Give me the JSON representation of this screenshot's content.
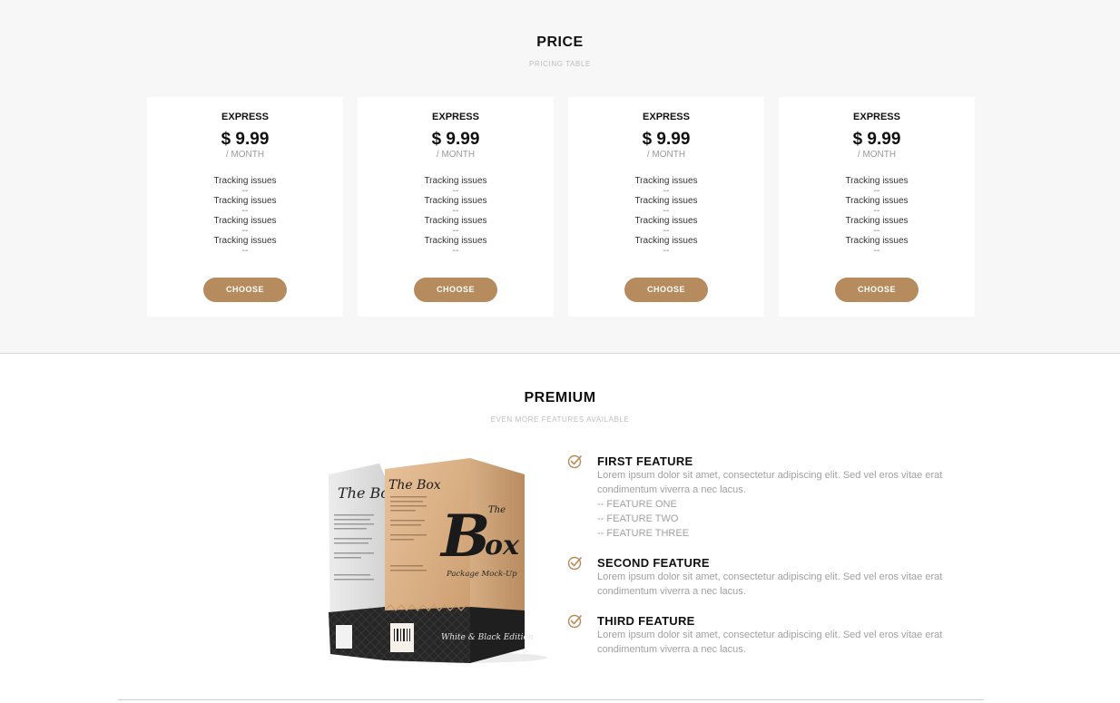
{
  "price": {
    "title": "PRICE",
    "subtitle": "PRICING TABLE",
    "cards": [
      {
        "name": "EXPRESS",
        "price": "$ 9.99",
        "period": "/ MONTH",
        "features": [
          "Tracking issues",
          "Tracking issues",
          "Tracking issues",
          "Tracking issues"
        ],
        "separator": "--",
        "button": "CHOOSE"
      },
      {
        "name": "EXPRESS",
        "price": "$ 9.99",
        "period": "/ MONTH",
        "features": [
          "Tracking issues",
          "Tracking issues",
          "Tracking issues",
          "Tracking issues"
        ],
        "separator": "--",
        "button": "CHOOSE"
      },
      {
        "name": "EXPRESS",
        "price": "$ 9.99",
        "period": "/ MONTH",
        "features": [
          "Tracking issues",
          "Tracking issues",
          "Tracking issues",
          "Tracking issues"
        ],
        "separator": "--",
        "button": "CHOOSE"
      },
      {
        "name": "EXPRESS",
        "price": "$ 9.99",
        "period": "/ MONTH",
        "features": [
          "Tracking issues",
          "Tracking issues",
          "Tracking issues",
          "Tracking issues"
        ],
        "separator": "--",
        "button": "CHOOSE"
      }
    ]
  },
  "premium": {
    "title": "PREMIUM",
    "subtitle": "EVEN MORE FEATURES AVAILABLE",
    "product_image": {
      "icon": "product-box-image",
      "box_front_brand": "The Box",
      "box_front_caption": "Package Mock-Up",
      "box_front_edition": "White & Black Edition",
      "box_back_brand": "The Box"
    },
    "features": [
      {
        "title": "FIRST FEATURE",
        "body": "Lorem ipsum dolor sit amet, consectetur adipiscing elit. Sed vel eros vitae erat condimentum viverra a nec lacus.",
        "subitems": [
          "-- FEATURE ONE",
          "-- FEATURE TWO",
          "-- FEATURE THREE"
        ]
      },
      {
        "title": "SECOND FEATURE",
        "body": "Lorem ipsum dolor sit amet, consectetur adipiscing elit. Sed vel eros vitae erat condimentum viverra a nec lacus.",
        "subitems": []
      },
      {
        "title": "THIRD FEATURE",
        "body": "Lorem ipsum dolor sit amet, consectetur adipiscing elit. Sed vel eros vitae erat condimentum viverra a nec lacus.",
        "subitems": []
      }
    ]
  },
  "colors": {
    "accent": "#b68b5d",
    "price_bg": "#f7f7f7",
    "muted_text": "#a0a0a0"
  }
}
